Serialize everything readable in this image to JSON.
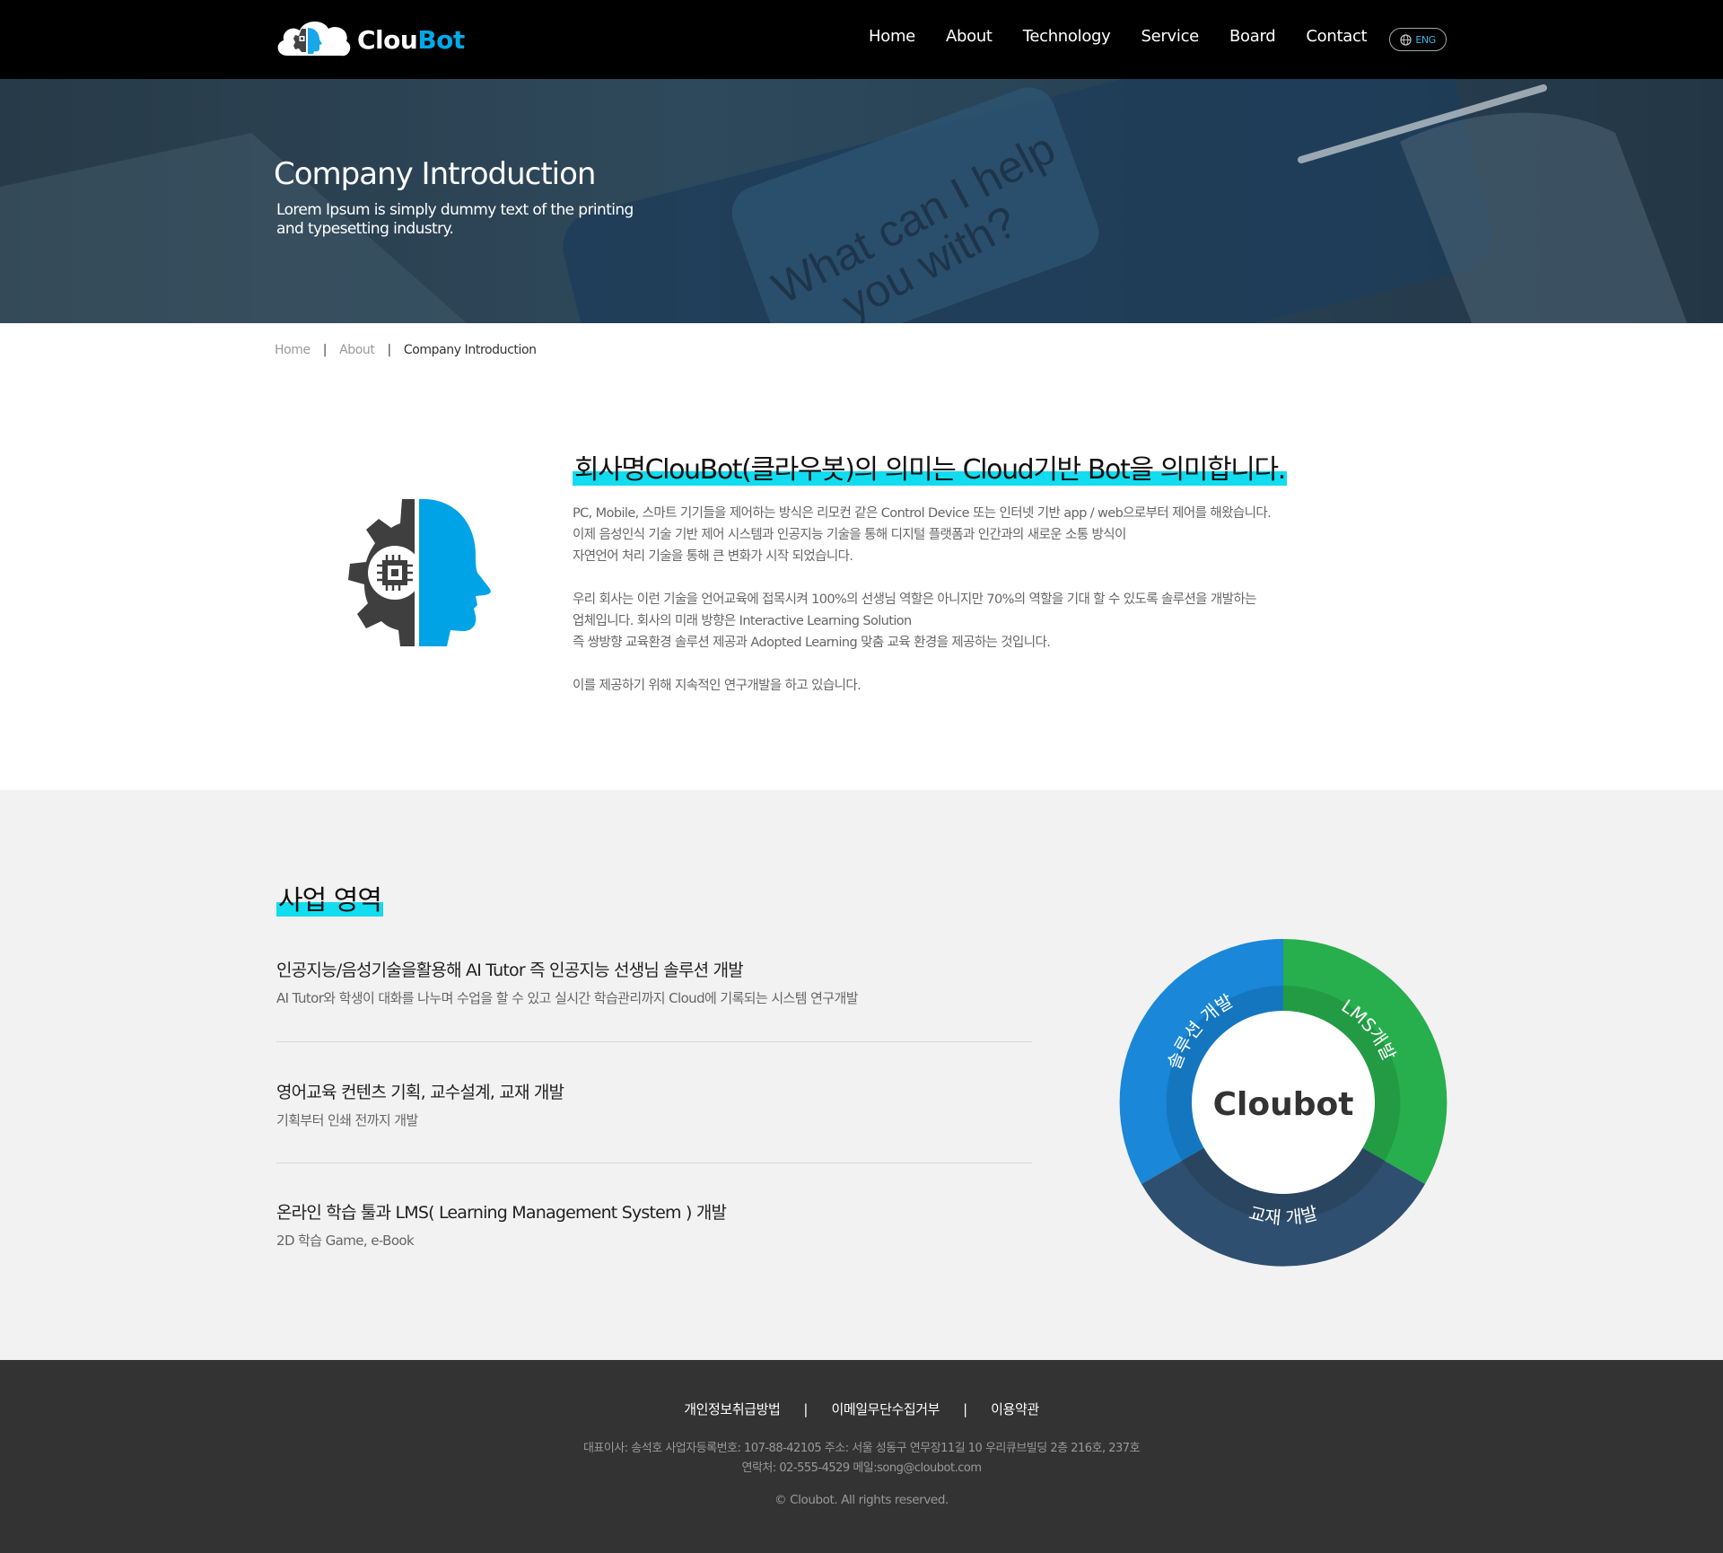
{
  "header": {
    "logo_text_1": "Clou",
    "logo_text_2": "Bot",
    "nav": [
      "Home",
      "About",
      "Technology",
      "Service",
      "Board",
      "Contact"
    ],
    "lang": "ENG"
  },
  "hero": {
    "title": "Company Introduction",
    "subtitle_1": "Lorem Ipsum is simply dummy text of the printing",
    "subtitle_2": "and typesetting industry.",
    "bg_text_1": "What can I help",
    "bg_text_2": "you with?"
  },
  "breadcrumb": {
    "home": "Home",
    "sep": "|",
    "about": "About",
    "current": "Company Introduction"
  },
  "intro": {
    "heading": "회사명ClouBot(클라우봇)의 의미는 Cloud기반 Bot을 의미합니다.",
    "para1": [
      "PC, Mobile, 스마트 기기들을 제어하는 방식은 리모컨 같은 Control Device 또는 인터넷 기반 app / web으로부터 제어를 해왔습니다.",
      "이제 음성인식 기술 기반 제어 시스템과 인공지능 기술을 통해 디지털 플랫폼과 인간과의 새로운 소통 방식이",
      "자연언어 처리 기술을 통해 큰 변화가 시작 되었습니다."
    ],
    "para2": [
      "우리 회사는 이런 기술을 언어교육에 접목시켜 100%의 선생님 역할은 아니지만 70%의 역할을 기대 할 수 있도록 솔루션을 개발하는",
      "업체입니다. 회사의 미래 방향은 Interactive Learning Solution",
      "즉 쌍방향 교육환경 솔루션 제공과 Adopted Learning 맞춤 교육 환경을 제공하는 것입니다."
    ],
    "para3": [
      "이를 제공하기 위해 지속적인 연구개발을 하고 있습니다."
    ]
  },
  "business": {
    "title": "사업 영역",
    "items": [
      {
        "title": "인공지능/음성기술을활용해 AI Tutor 즉 인공지능 선생님 솔루션 개발",
        "desc": "AI Tutor와 학생이 대화를 나누며 수업을 할 수 있고 실시간 학습관리까지 Cloud에 기록되는 시스템 연구개발"
      },
      {
        "title": "영어교육 컨텐츠 기획, 교수설계, 교재 개발",
        "desc": "기획부터 인쇄 전까지 개발"
      },
      {
        "title": "온라인 학습 툴과 LMS( Learning Management System ) 개발",
        "desc": "2D 학습 Game, e-Book"
      }
    ],
    "donut": {
      "center": "Cloubot",
      "segments": [
        {
          "label": "솔루션 개발",
          "color": "#1a87d8"
        },
        {
          "label": "LMS개발",
          "color": "#27ae4d"
        },
        {
          "label": "교재 개발",
          "color": "#2f4f70"
        }
      ]
    }
  },
  "footer": {
    "links": [
      "개인정보취급방법",
      "이메일무단수집거부",
      "이용약관"
    ],
    "sep": "|",
    "info_1": "대표이사: 송석호 사업자등록번호: 107-88-42105 주소: 서울 성동구 연무장11길 10 우리큐브빌딩 2층 216호, 237호",
    "info_2": "연락처: 02-555-4529 메일:song@cloubot.com",
    "copyright": "© Cloubot. All rights reserved."
  }
}
